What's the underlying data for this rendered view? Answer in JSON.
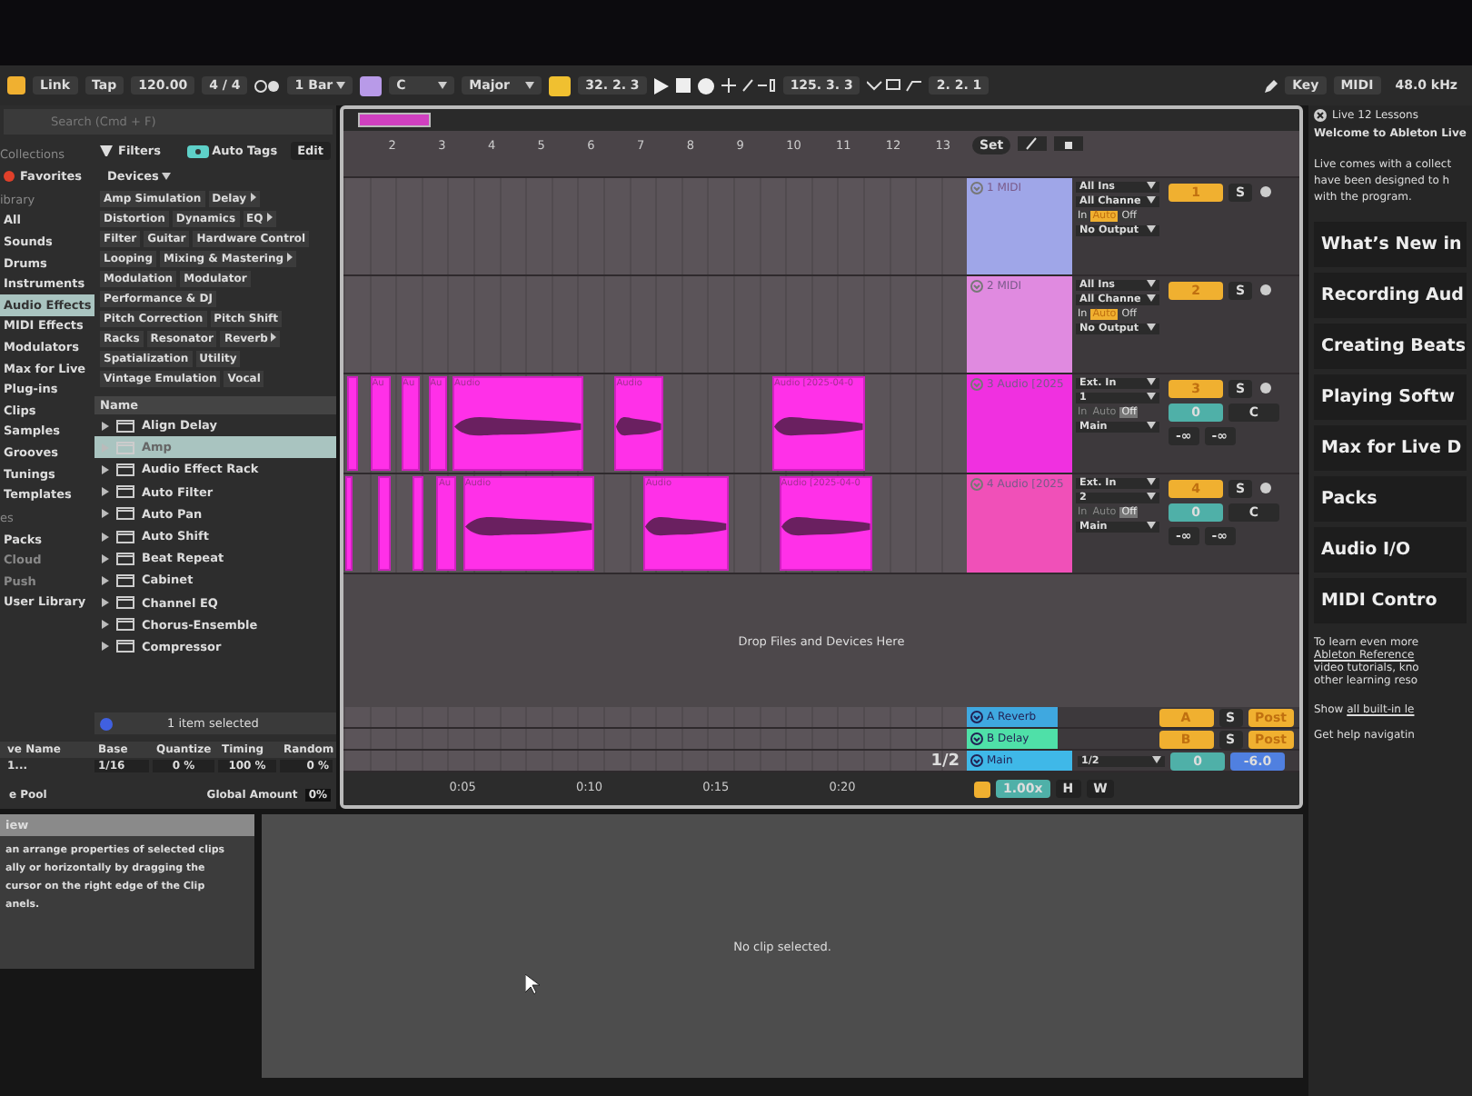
{
  "toolbar": {
    "link": "Link",
    "tap": "Tap",
    "tempo": "120.00",
    "time_signature": "4 / 4",
    "quantization": "1 Bar",
    "key": "C",
    "scale": "Major",
    "position": "32. 2. 3",
    "loop_start": "125. 3. 3",
    "loop_length": "2. 2. 1",
    "key_map": "Key",
    "midi_map": "MIDI",
    "sample_rate": "48.0 kHz"
  },
  "browser": {
    "search": {
      "placeholder": "Search (Cmd + F)"
    },
    "collections": {
      "heading": "Collections",
      "items": [
        {
          "label": "Favorites",
          "color": "#e0402a"
        }
      ]
    },
    "library": {
      "heading": "ibrary",
      "items": [
        {
          "label": "All",
          "selected": false
        },
        {
          "label": "Sounds",
          "selected": false
        },
        {
          "label": "Drums",
          "selected": false
        },
        {
          "label": "Instruments",
          "selected": false
        },
        {
          "label": "Audio Effects",
          "selected": true
        },
        {
          "label": "MIDI Effects",
          "selected": false
        },
        {
          "label": "Modulators",
          "selected": false
        },
        {
          "label": "Max for Live",
          "selected": false
        },
        {
          "label": "Plug-ins",
          "selected": false
        },
        {
          "label": "Clips",
          "selected": false
        },
        {
          "label": "Samples",
          "selected": false
        },
        {
          "label": "Grooves",
          "selected": false
        },
        {
          "label": "Tunings",
          "selected": false
        },
        {
          "label": "Templates",
          "selected": false
        }
      ]
    },
    "places": {
      "heading": "es",
      "items": [
        {
          "label": "Packs",
          "disabled": false
        },
        {
          "label": "Cloud",
          "disabled": true
        },
        {
          "label": "Push",
          "disabled": true
        },
        {
          "label": "User Library",
          "disabled": false
        }
      ]
    },
    "filters": {
      "label": "Filters",
      "auto_tags": "Auto Tags",
      "edit": "Edit",
      "category": "Devices",
      "tag_rows": [
        [
          {
            "label": "Amp Simulation",
            "more": false
          },
          {
            "label": "Delay",
            "more": true
          }
        ],
        [
          {
            "label": "Distortion",
            "more": false
          },
          {
            "label": "Dynamics",
            "more": false
          },
          {
            "label": "EQ",
            "more": true
          }
        ],
        [
          {
            "label": "Filter",
            "more": false
          },
          {
            "label": "Guitar",
            "more": false
          },
          {
            "label": "Hardware Control",
            "more": false
          }
        ],
        [
          {
            "label": "Looping",
            "more": false
          },
          {
            "label": "Mixing & Mastering",
            "more": true
          }
        ],
        [
          {
            "label": "Modulation",
            "more": false
          },
          {
            "label": "Modulator",
            "more": false
          }
        ],
        [
          {
            "label": "Performance & DJ",
            "more": false
          }
        ],
        [
          {
            "label": "Pitch Correction",
            "more": false
          },
          {
            "label": "Pitch Shift",
            "more": false
          }
        ],
        [
          {
            "label": "Racks",
            "more": false
          },
          {
            "label": "Resonator",
            "more": false
          },
          {
            "label": "Reverb",
            "more": true
          }
        ],
        [
          {
            "label": "Spatialization",
            "more": false
          },
          {
            "label": "Utility",
            "more": false
          }
        ],
        [
          {
            "label": "Vintage Emulation",
            "more": false
          },
          {
            "label": "Vocal",
            "more": false
          }
        ]
      ]
    },
    "list": {
      "column": "Name",
      "items": [
        {
          "label": "Align Delay",
          "selected": false
        },
        {
          "label": "Amp",
          "selected": true
        },
        {
          "label": "Audio Effect Rack",
          "selected": false
        },
        {
          "label": "Auto Filter",
          "selected": false
        },
        {
          "label": "Auto Pan",
          "selected": false
        },
        {
          "label": "Auto Shift",
          "selected": false
        },
        {
          "label": "Beat Repeat",
          "selected": false
        },
        {
          "label": "Cabinet",
          "selected": false
        },
        {
          "label": "Channel EQ",
          "selected": false
        },
        {
          "label": "Chorus-Ensemble",
          "selected": false
        },
        {
          "label": "Compressor",
          "selected": false
        }
      ],
      "status": "1 item selected"
    }
  },
  "groove_pool": {
    "columns": [
      "ve Name",
      "Base",
      "Quantize",
      "Timing",
      "Random"
    ],
    "row": {
      "name": "1...",
      "base": "1/16",
      "quantize": "0 %",
      "timing": "100 %",
      "random": "0 %"
    },
    "title": "e Pool",
    "global_amount_label": "Global Amount",
    "global_amount": "0%"
  },
  "info_view": {
    "title": "iew",
    "lines": [
      "an arrange properties of selected clips",
      "ally or horizontally by dragging the",
      "cursor on the right edge of the Clip",
      "anels."
    ]
  },
  "arrangement": {
    "bars": [
      "2",
      "3",
      "4",
      "5",
      "6",
      "7",
      "8",
      "9",
      "10",
      "11",
      "12",
      "13"
    ],
    "set": "Set",
    "tracks": [
      {
        "kind": "midi",
        "name": "1 MIDI",
        "color": "#9fa6e8",
        "input": "All Ins",
        "channel": "All Channe",
        "monitor": [
          {
            "label": "In",
            "selected": false
          },
          {
            "label": "Auto",
            "selected": true
          },
          {
            "label": "Off",
            "selected": false
          }
        ],
        "output": "No Output",
        "number": "1",
        "solo": "S"
      },
      {
        "kind": "midi",
        "name": "2 MIDI",
        "color": "#e08ae0",
        "input": "All Ins",
        "channel": "All Channe",
        "monitor": [
          {
            "label": "In",
            "selected": false
          },
          {
            "label": "Auto",
            "selected": true
          },
          {
            "label": "Off",
            "selected": false
          }
        ],
        "output": "No Output",
        "number": "2",
        "solo": "S"
      },
      {
        "kind": "audio",
        "name": "3 Audio [2025",
        "color": "#f030e0",
        "input": "Ext. In",
        "channel": "1",
        "monitor": [
          {
            "label": "In",
            "selected": false
          },
          {
            "label": "Auto",
            "selected": false
          },
          {
            "label": "Off",
            "selected": true
          }
        ],
        "output": "Main",
        "number": "3",
        "solo": "S",
        "volume": "0",
        "pan": "C",
        "peaks": [
          "-∞",
          "-∞"
        ],
        "clips": [
          {
            "selected": false
          },
          {
            "label": "Au",
            "selected": false
          },
          {
            "label": "Au",
            "selected": false
          },
          {
            "label": "Au",
            "selected": false
          },
          {
            "label": "Audio",
            "selected": false
          },
          {
            "label": "Audio",
            "selected": false
          },
          {
            "label": "Audio [2025-04-0",
            "selected": false
          }
        ]
      },
      {
        "kind": "audio",
        "name": "4 Audio [2025",
        "color": "#f050b8",
        "input": "Ext. In",
        "channel": "2",
        "monitor": [
          {
            "label": "In",
            "selected": false
          },
          {
            "label": "Auto",
            "selected": false
          },
          {
            "label": "Off",
            "selected": true
          }
        ],
        "output": "Main",
        "number": "4",
        "solo": "S",
        "volume": "0",
        "pan": "C",
        "peaks": [
          "-∞",
          "-∞"
        ],
        "clips": [
          {
            "selected": false
          },
          {
            "selected": false
          },
          {
            "selected": false
          },
          {
            "label": "Au",
            "selected": false
          },
          {
            "label": "Audio",
            "selected": false
          },
          {
            "label": "Audio",
            "selected": false
          },
          {
            "label": "Audio [2025-04-0",
            "selected": false
          }
        ]
      }
    ],
    "drop_hint": "Drop Files and Devices Here",
    "returns": [
      {
        "kind": "return",
        "name": "A Reverb",
        "color": "#3fa8e0",
        "send": "A",
        "solo": "S",
        "post": "Post"
      },
      {
        "kind": "return",
        "name": "B Delay",
        "color": "#4fe0a8",
        "send": "B",
        "solo": "S",
        "post": "Post"
      },
      {
        "kind": "main",
        "name": "Main",
        "color": "#3fb8e8",
        "output": "1/2",
        "volume": "0",
        "gain": "-6.0"
      }
    ],
    "page": "1/2",
    "times": [
      "0:05",
      "0:10",
      "0:15",
      "0:20"
    ],
    "zoom": "1.00x",
    "h": "H",
    "w": "W"
  },
  "detail": {
    "message": "No clip selected."
  },
  "lessons": {
    "title": "Live 12 Lessons",
    "heading": "Welcome to Ableton Live",
    "intro": [
      "Live comes with a collect",
      "have been designed to h",
      "with the program."
    ],
    "buttons": [
      "What’s New in",
      "Recording Aud",
      "Creating Beats",
      "Playing Softw",
      "Max for Live D",
      "Packs",
      "Audio I/O",
      "MIDI Contro"
    ],
    "footer": [
      {
        "text": "To learn even more",
        "link": false
      },
      {
        "text": "Ableton Reference",
        "link": true
      },
      {
        "text": "video tutorials, kno",
        "link": false
      },
      {
        "text": "other learning reso",
        "link": false
      }
    ],
    "show_all": {
      "prefix": "Show ",
      "link": "all built-in le"
    },
    "help": "Get help navigatin"
  }
}
